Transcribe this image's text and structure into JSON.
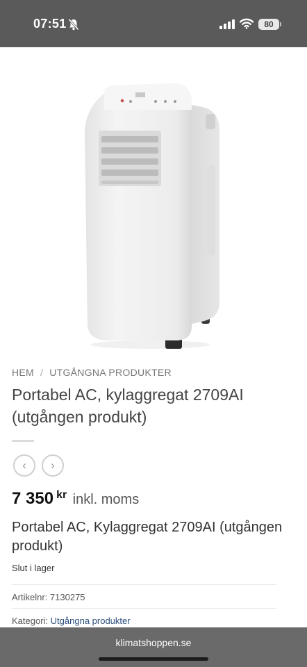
{
  "status": {
    "time": "07:51",
    "battery": "80"
  },
  "breadcrumb": {
    "home": "HEM",
    "separator": "/",
    "category": "UTGÅNGNA PRODUKTER"
  },
  "product": {
    "title": "Portabel AC, kylaggregat 2709AI (utgången produkt)",
    "price_amount": "7 350",
    "price_currency": "kr",
    "price_tax": "inkl. moms",
    "subtitle": "Portabel AC, Kylaggregat 2709AI (utgången produkt)",
    "stock": "Slut i lager",
    "sku_label": "Artikelnr:",
    "sku": "7130275",
    "category_label": "Kategori:",
    "category": "Utgångna produkter"
  },
  "gallery_nav": {
    "prev_icon": "‹",
    "next_icon": "›"
  },
  "browser": {
    "url": "klimatshoppen.se"
  }
}
